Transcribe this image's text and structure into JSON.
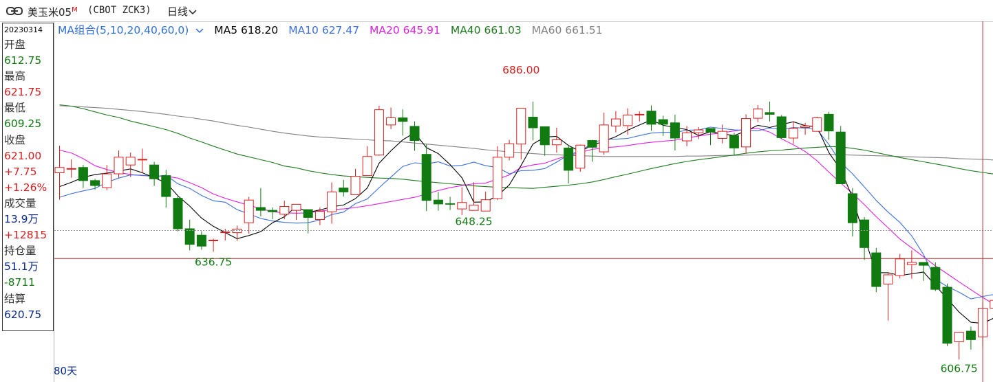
{
  "header": {
    "title": "美玉米05",
    "title_sup": "M",
    "code": "(CBOT ZCK3)",
    "period": "日线"
  },
  "info": {
    "date": "20230314",
    "open_label": "开盘",
    "open": "612.75",
    "high_label": "最高",
    "high": "621.75",
    "low_label": "最低",
    "low": "609.25",
    "close_label": "收盘",
    "close": "621.00",
    "change": "+7.75",
    "change_pct": "+1.26%",
    "volume_label": "成交量",
    "volume": "13.9万",
    "volume_change": "+12815",
    "oi_label": "持仓量",
    "oi": "51.1万",
    "oi_change": "-8711",
    "settle_label": "结算",
    "settle": "620.75"
  },
  "legend": {
    "combo": "MA组合(5,10,20,40,60,0)",
    "ma5": "MA5 618.20",
    "ma10": "MA10 627.47",
    "ma20": "MA20 645.91",
    "ma40": "MA40 661.03",
    "ma60": "MA60 661.51"
  },
  "colors": {
    "up": "#d81e1e",
    "down": "#117a11",
    "ma5": "#000000",
    "ma10": "#3b6fd9",
    "ma20": "#e020e0",
    "ma40": "#1e7a1e",
    "ma60": "#808080"
  },
  "chart_data": {
    "type": "candlestick",
    "ylim": [
      604.9,
      697.2
    ],
    "candles": [
      [
        659.1,
        660.6,
        666.7,
        651.5
      ],
      [
        660.3,
        660.3,
        662.9,
        657.7
      ],
      [
        660.6,
        656.9,
        661.3,
        654.8
      ],
      [
        656.9,
        655.5,
        657.4,
        654.4
      ],
      [
        654.9,
        658.8,
        661.3,
        654.2
      ],
      [
        658.8,
        663.5,
        665.4,
        657.7
      ],
      [
        661.3,
        663.5,
        664.8,
        657.9
      ],
      [
        662.9,
        662.9,
        665.9,
        659.1
      ],
      [
        661.3,
        657.4,
        662.2,
        655.4
      ],
      [
        658.3,
        652.4,
        659.9,
        649.3
      ],
      [
        651.9,
        643.3,
        652.6,
        642.6
      ],
      [
        643.3,
        638.9,
        645.9,
        637.2
      ],
      [
        641.5,
        638.4,
        642.6,
        637.4
      ],
      [
        640.1,
        640.1,
        640.5,
        636.8
      ],
      [
        642.4,
        642.4,
        643.3,
        640.0
      ],
      [
        642.2,
        643.2,
        644.2,
        639.9
      ],
      [
        645.0,
        651.4,
        652.3,
        641.9
      ],
      [
        649.3,
        648.5,
        654.8,
        646.8
      ],
      [
        648.5,
        648.1,
        649.3,
        646.0
      ],
      [
        647.4,
        649.6,
        651.2,
        646.0
      ],
      [
        648.5,
        650.2,
        649.7,
        645.8
      ],
      [
        648.7,
        646.5,
        648.7,
        642.0
      ],
      [
        645.9,
        648.2,
        649.3,
        644.3
      ],
      [
        648.1,
        653.7,
        656.4,
        644.7
      ],
      [
        654.8,
        653.7,
        657.1,
        652.4
      ],
      [
        652.9,
        658.1,
        660.2,
        652.9
      ],
      [
        658.3,
        663.7,
        666.6,
        659.4
      ],
      [
        664.1,
        676.9,
        678.0,
        663.9
      ],
      [
        672.6,
        674.6,
        677.5,
        671.4
      ],
      [
        674.6,
        673.6,
        677.0,
        669.6
      ],
      [
        672.2,
        668.2,
        673.6,
        665.3
      ],
      [
        664.3,
        651.3,
        667.1,
        648.3
      ],
      [
        651.4,
        650.3,
        653.7,
        648.4
      ],
      [
        650.4,
        650.3,
        652.3,
        648.6
      ],
      [
        648.9,
        650.7,
        655.0,
        647.2
      ],
      [
        648.5,
        650.0,
        656.4,
        649.3
      ],
      [
        648.3,
        651.5,
        653.8,
        650.8
      ],
      [
        651.8,
        663.5,
        666.6,
        651.4
      ],
      [
        663.5,
        667.3,
        668.4,
        662.6
      ],
      [
        667.2,
        677.3,
        677.2,
        662.9
      ],
      [
        674.8,
        671.8,
        679.2,
        668.2
      ],
      [
        672.1,
        667.0,
        668.1,
        663.9
      ],
      [
        667.0,
        668.4,
        671.8,
        664.8
      ],
      [
        666.1,
        659.8,
        667.0,
        656.1
      ],
      [
        660.4,
        666.9,
        667.1,
        659.4
      ],
      [
        668.2,
        666.3,
        668.4,
        662.2
      ],
      [
        665.0,
        672.6,
        676.1,
        664.2
      ],
      [
        672.3,
        674.3,
        676.5,
        670.5
      ],
      [
        672.4,
        675.4,
        677.3,
        669.8
      ],
      [
        675.5,
        675.6,
        676.4,
        673.6
      ],
      [
        676.5,
        672.8,
        678.1,
        671.0
      ],
      [
        674.1,
        672.8,
        675.2,
        669.5
      ],
      [
        673.2,
        668.9,
        675.5,
        665.4
      ],
      [
        668.1,
        670.4,
        672.3,
        666.6
      ],
      [
        670.4,
        671.2,
        672.0,
        668.6
      ],
      [
        671.6,
        670.6,
        671.5,
        666.9
      ],
      [
        668.8,
        670.8,
        672.7,
        667.4
      ],
      [
        669.6,
        666.1,
        670.4,
        664.1
      ],
      [
        666.4,
        674.4,
        675.6,
        664.5
      ],
      [
        674.5,
        677.1,
        678.2,
        673.4
      ],
      [
        676.1,
        675.6,
        679.2,
        673.6
      ],
      [
        674.9,
        669.0,
        675.4,
        668.8
      ],
      [
        668.9,
        671.6,
        673.6,
        667.3
      ],
      [
        671.9,
        672.3,
        673.2,
        669.8
      ],
      [
        670.8,
        674.6,
        674.9,
        672.1
      ],
      [
        675.6,
        670.9,
        676.3,
        668.4
      ],
      [
        670.6,
        656.0,
        672.3,
        655.9
      ],
      [
        653.2,
        645.0,
        654.8,
        641.1
      ],
      [
        645.8,
        638.0,
        646.6,
        634.5
      ],
      [
        636.5,
        627.0,
        637.9,
        625.4
      ],
      [
        627.7,
        630.3,
        631.0,
        617.4
      ],
      [
        630.1,
        634.8,
        636.2,
        629.3
      ],
      [
        633.2,
        633.8,
        637.2,
        629.2
      ],
      [
        633.8,
        633.0,
        633.8,
        628.6
      ],
      [
        632.4,
        626.2,
        633.8,
        625.7
      ],
      [
        626.8,
        611.0,
        627.8,
        610.2
      ],
      [
        611.4,
        614.1,
        614.1,
        606.4
      ],
      [
        614.4,
        612.0,
        615.7,
        609.2
      ],
      [
        612.8,
        620.9,
        622.5,
        610.0
      ],
      [
        620.9,
        623.1,
        623.7,
        620.0
      ]
    ],
    "ma5": [
      655.2,
      656.4,
      657.8,
      658.6,
      659.0,
      659.6,
      660.2,
      659.1,
      657.7,
      656.3,
      652.6,
      649.7,
      646.3,
      644.0,
      642.2,
      640.5,
      641.4,
      642.5,
      645.0,
      646.7,
      649.6,
      647.9,
      648.6,
      649.5,
      650.0,
      651.8,
      654.8,
      661.8,
      665.3,
      668.4,
      670.4,
      666.2,
      664.5,
      661.4,
      657.7,
      650.8,
      650.9,
      652.6,
      655.7,
      661.2,
      667.2,
      669.2,
      669.4,
      666.8,
      665.1,
      666.9,
      668.0,
      669.3,
      671.1,
      672.6,
      674.0,
      672.5,
      671.9,
      671.3,
      669.6,
      670.7,
      670.1,
      669.6,
      670.9,
      672.5,
      671.9,
      672.7,
      673.5,
      672.4,
      672.1,
      664.8,
      660.0,
      652.1,
      640.9,
      630.9,
      630.9,
      630.1,
      630.6,
      631.1,
      627.3,
      623.6,
      619.8,
      616.9,
      616.6,
      618.2
    ],
    "ma10": [
      652.2,
      653.2,
      654.0,
      654.7,
      656.4,
      657.6,
      658.5,
      658.4,
      658.0,
      658.4,
      656.0,
      654.7,
      652.7,
      651.2,
      650.8,
      648.7,
      647.5,
      646.2,
      645.5,
      645.1,
      644.9,
      645.0,
      645.8,
      647.3,
      648.0,
      650.4,
      651.7,
      654.9,
      657.9,
      660.9,
      661.9,
      661.6,
      662.2,
      661.0,
      661.2,
      662.1,
      661.1,
      660.6,
      658.8,
      659.7,
      659.8,
      660.3,
      662.1,
      664.2,
      665.2,
      667.4,
      668.7,
      668.6,
      668.8,
      669.6,
      670.3,
      670.5,
      670.5,
      671.1,
      671.2,
      672.0,
      671.6,
      671.2,
      671.1,
      671.0,
      671.7,
      671.4,
      671.9,
      671.7,
      671.3,
      667.1,
      662.0,
      658.8,
      655.1,
      651.3,
      648.0,
      645.1,
      641.3,
      636.0,
      629.0,
      627.0,
      625.4,
      623.5,
      624.2,
      624.8
    ],
    "ma20": [
      665.5,
      664.7,
      663.1,
      661.1,
      660.0,
      659.2,
      658.6,
      658.3,
      658.2,
      658.1,
      657.6,
      656.3,
      654.9,
      653.1,
      651.9,
      650.9,
      649.9,
      649.0,
      648.1,
      647.8,
      647.7,
      647.8,
      648.3,
      648.7,
      648.9,
      649.3,
      649.8,
      650.4,
      651.0,
      651.6,
      652.2,
      653.1,
      654.1,
      654.9,
      655.5,
      656.0,
      656.2,
      657.3,
      658.5,
      660.6,
      661.3,
      661.8,
      663.0,
      664.0,
      664.8,
      665.7,
      666.2,
      666.4,
      666.8,
      667.3,
      667.7,
      668.0,
      668.3,
      668.9,
      669.5,
      670.0,
      670.4,
      670.9,
      671.4,
      671.6,
      670.6,
      668.7,
      667.0,
      665.1,
      662.5,
      659.3,
      656.2,
      653.3,
      650.1,
      646.7,
      643.6,
      640.4,
      637.9,
      635.4,
      632.8,
      630.6,
      628.3,
      626.1,
      623.9,
      621.9
    ],
    "ma40": [
      678.3,
      677.9,
      677.2,
      676.3,
      675.4,
      674.7,
      673.7,
      672.9,
      672.1,
      671.3,
      670.2,
      668.9,
      667.8,
      666.6,
      665.5,
      664.4,
      663.6,
      662.8,
      662.0,
      661.0,
      660.5,
      659.7,
      659.1,
      658.6,
      658.2,
      658.0,
      657.8,
      657.6,
      657.5,
      657.3,
      656.9,
      656.6,
      656.3,
      656.0,
      655.7,
      655.4,
      655.2,
      655.0,
      654.9,
      654.8,
      654.7,
      655.0,
      655.3,
      655.6,
      656.0,
      656.5,
      657.2,
      658.0,
      658.7,
      659.5,
      660.3,
      661.0,
      661.7,
      662.3,
      662.8,
      663.2,
      663.7,
      664.1,
      664.6,
      665.0,
      665.3,
      665.5,
      665.8,
      666.1,
      666.3,
      666.5,
      666.4,
      666.0,
      665.5,
      664.8,
      664.1,
      663.4,
      662.8,
      662.2,
      661.6,
      661.0,
      660.3,
      659.7,
      659.2,
      658.7
    ],
    "ma60": [
      678.0,
      677.9,
      677.7,
      677.5,
      677.3,
      677.0,
      676.7,
      676.4,
      676.0,
      675.6,
      675.1,
      674.7,
      674.2,
      673.7,
      673.1,
      672.5,
      672.0,
      671.4,
      670.8,
      670.3,
      669.9,
      669.5,
      669.2,
      669.0,
      668.8,
      668.6,
      668.4,
      668.2,
      668.1,
      667.8,
      667.5,
      667.2,
      666.9,
      666.6,
      666.3,
      666.0,
      665.6,
      665.3,
      665.0,
      664.8,
      664.5,
      664.3,
      664.2,
      664.0,
      663.9,
      663.8,
      663.7,
      663.7,
      663.7,
      663.7,
      663.7,
      663.7,
      663.7,
      663.8,
      663.8,
      663.9,
      664.0,
      664.0,
      664.1,
      664.2,
      664.3,
      664.3,
      664.3,
      664.3,
      664.3,
      664.3,
      664.2,
      664.1,
      664.0,
      663.9,
      663.8,
      663.7,
      663.6,
      663.5,
      663.4,
      663.3,
      663.1,
      663.0,
      662.9,
      662.7
    ],
    "annotations": [
      {
        "text": "686.00",
        "index": 39,
        "value": 686.0,
        "pos": "above",
        "color": "up"
      },
      {
        "text": "648.25",
        "index": 35,
        "value": 648.25,
        "pos": "below",
        "color": "down"
      },
      {
        "text": "636.75",
        "index": 13,
        "value": 636.75,
        "pos": "below",
        "color": "down"
      },
      {
        "text": "606.75",
        "index": 76,
        "value": 606.75,
        "pos": "below",
        "color": "down"
      }
    ],
    "crosshair": {
      "index": 78,
      "value": 642.8
    },
    "reference_value": 634.9,
    "period_label": "80天"
  }
}
